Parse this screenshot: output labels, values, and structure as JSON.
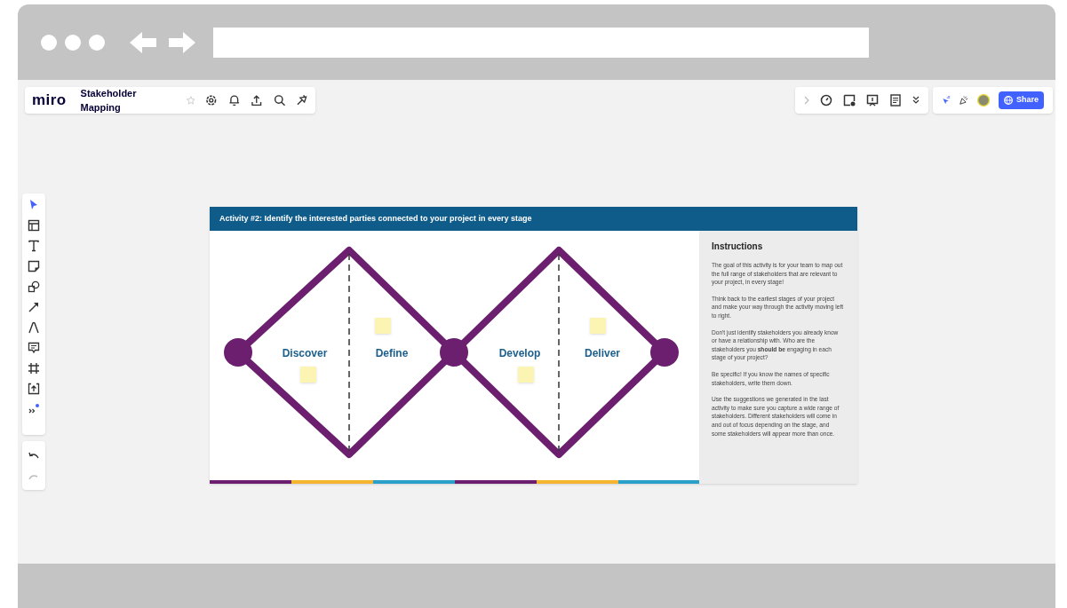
{
  "toolbar": {
    "logo": "miro",
    "board_title": "Stakeholder Mapping",
    "share_button": "Share"
  },
  "board": {
    "header": "Activity #2:  Identify the interested parties connected to your project in every stage",
    "stages": [
      {
        "name": "Discover"
      },
      {
        "name": "Define"
      },
      {
        "name": "Develop"
      },
      {
        "name": "Deliver"
      }
    ],
    "instructions": {
      "title": "Instructions",
      "paragraphs": [
        "The goal of this activity is for your team to map out the full range of stakeholders that are relevant to your project, in every stage!",
        "Think back to the earliest stages of your project and make your way through the activity moving left to right.",
        "Don't just identify stakeholders you already know or have a relationship with. Who are the stakeholders you **should be** engaging in each stage of your project?",
        "Be specific! If you know the names of specific stakeholders, write them down.",
        "Use the suggestions we generated in the last activity to make sure you capture a wide range of stakeholders. Different stakeholders will come in and out of focus depending on the stage, and some stakeholders will appear more than once."
      ]
    }
  }
}
